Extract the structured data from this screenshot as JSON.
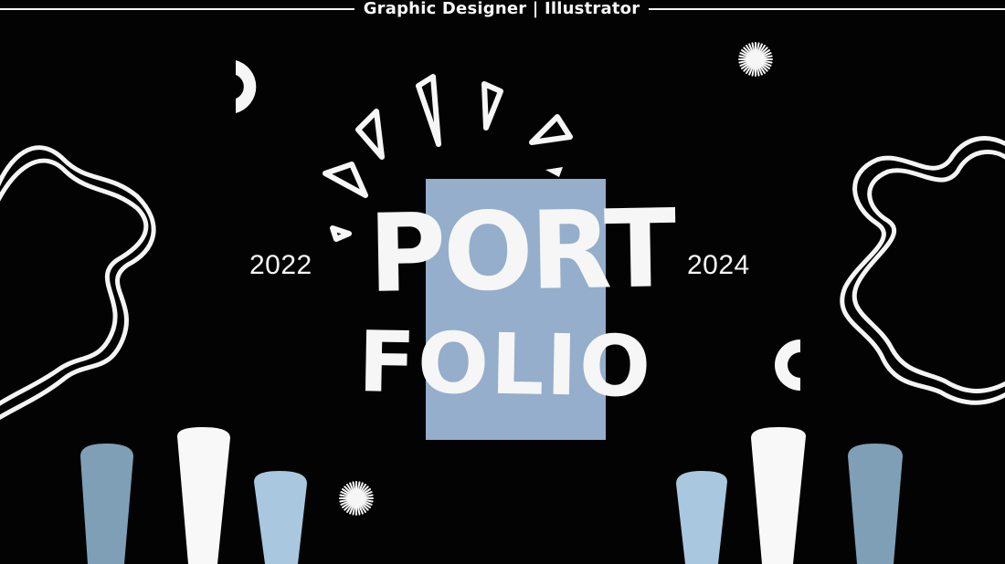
{
  "header": {
    "subtitle": "Graphic Designer | Illustrator"
  },
  "title": {
    "line1": "PORT",
    "line2": "FOLIO"
  },
  "years": {
    "start": "2022",
    "end": "2024"
  },
  "colors": {
    "background": "#030303",
    "foreground": "#f6f6f6",
    "accent_blue": "#94aecb",
    "steel_blue": "#7fa0b8",
    "light_blue": "#a9c7df"
  },
  "icons": [
    "moon-icon",
    "starburst-icon",
    "squiggle-shape",
    "triangle-shard",
    "pill-shape"
  ]
}
